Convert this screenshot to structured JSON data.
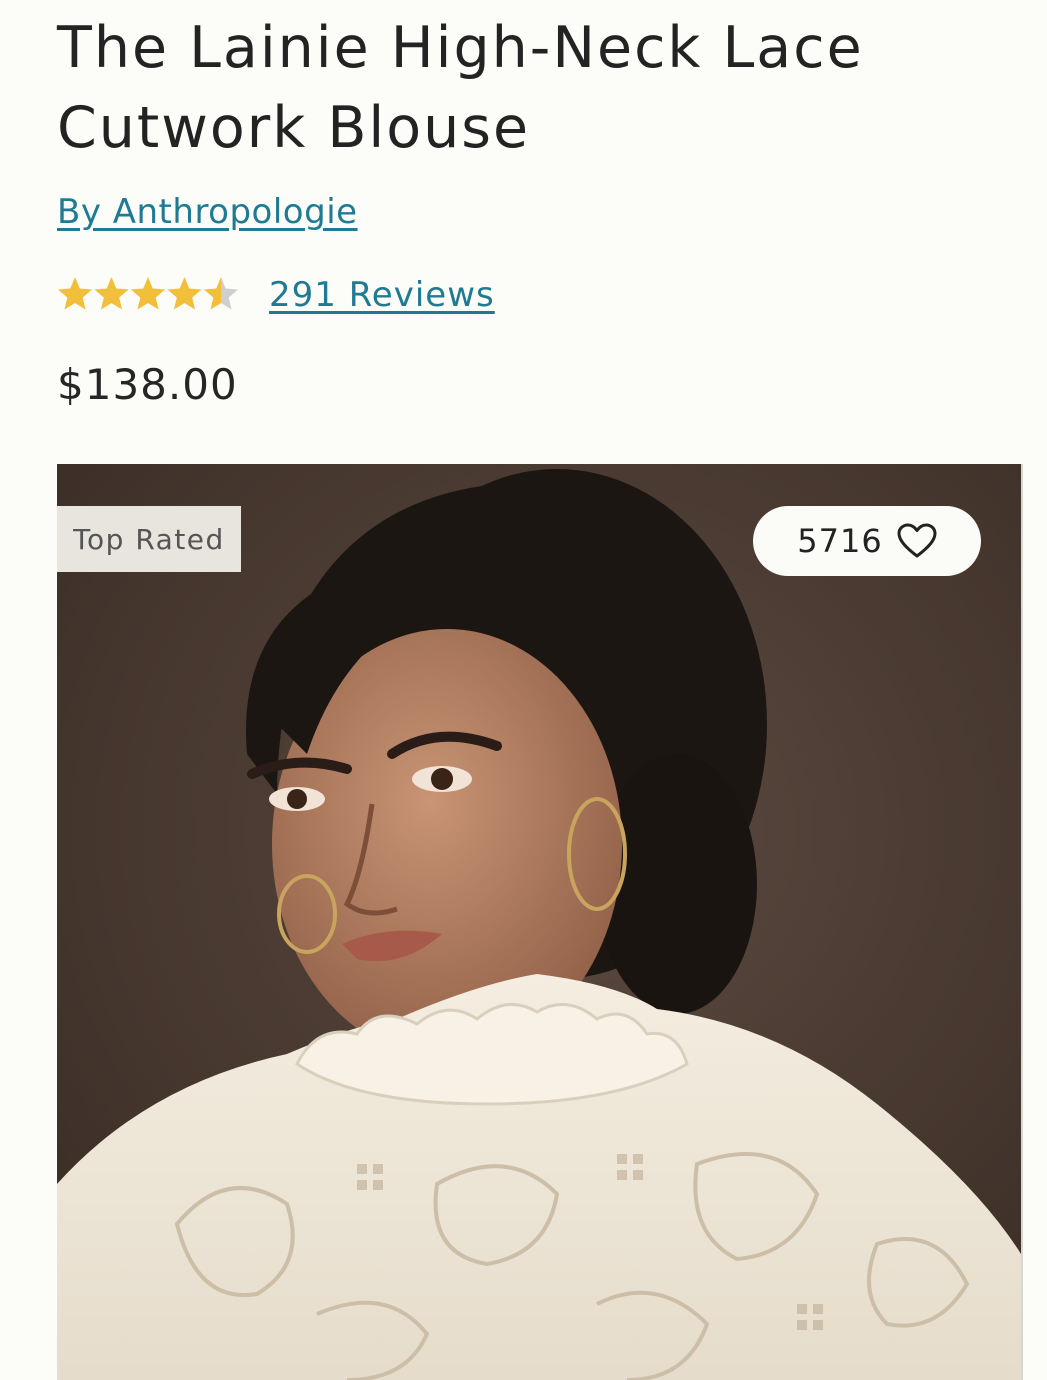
{
  "product": {
    "title": "The Lainie High-Neck Lace Cutwork Blouse",
    "brand_link": "By Anthropologie",
    "rating": {
      "value": 4.5,
      "max": 5,
      "star_color": "#f2bf3a",
      "empty_star_color": "#cfcfcf",
      "reviews_label": "291 Reviews"
    },
    "price": "$138.00"
  },
  "media": {
    "badge": "Top Rated",
    "favorites_count": "5716",
    "favorite_icon": "heart-outline-icon"
  },
  "colors": {
    "link": "#1f7a93",
    "background": "#fcfcf8",
    "photo_backdrop": "#4a3a32"
  }
}
